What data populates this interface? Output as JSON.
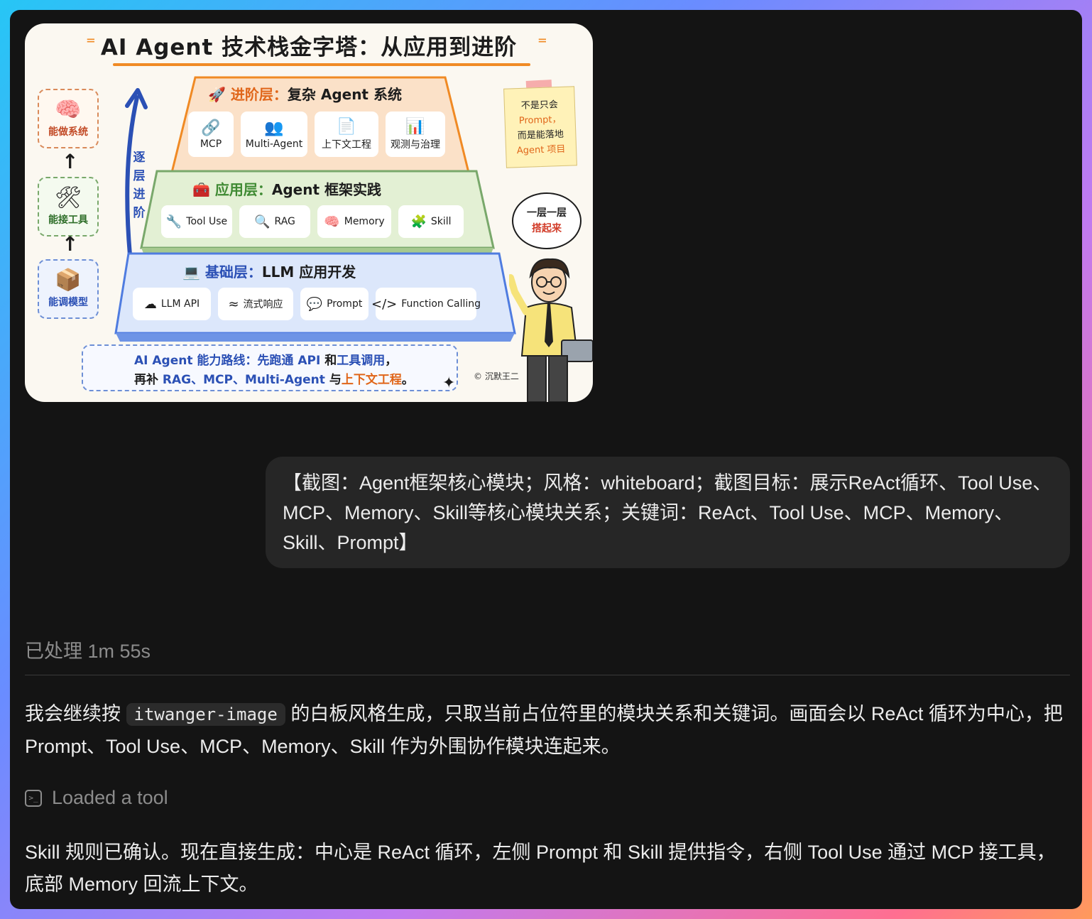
{
  "image": {
    "title": "AI Agent 技术栈金字塔：从应用到进阶",
    "side_labels": [
      "能做系统",
      "能接工具",
      "能调模型"
    ],
    "climb_text": "逐层进阶",
    "advanced": {
      "title_prefix": "进阶层：",
      "title_rest": "复杂 Agent 系统",
      "items": [
        {
          "label": "MCP",
          "icon": "link-icon"
        },
        {
          "label": "Multi-Agent",
          "icon": "people-icon"
        },
        {
          "label": "上下文工程",
          "icon": "document-icon"
        },
        {
          "label": "观测与治理",
          "icon": "dashboard-icon"
        }
      ]
    },
    "application": {
      "title_prefix": "应用层：",
      "title_rest": "Agent 框架实践",
      "items": [
        {
          "label": "Tool Use",
          "icon": "wrench-icon"
        },
        {
          "label": "RAG",
          "icon": "magnifier-icon"
        },
        {
          "label": "Memory",
          "icon": "brain-icon"
        },
        {
          "label": "Skill",
          "icon": "puzzle-icon"
        }
      ]
    },
    "foundation": {
      "title_prefix": "基础层：",
      "title_rest": "LLM 应用开发",
      "items": [
        {
          "label": "LLM API",
          "icon": "cloud-api-icon"
        },
        {
          "label": "流式响应",
          "icon": "wave-icon"
        },
        {
          "label": "Prompt",
          "icon": "chat-bubble-icon"
        },
        {
          "label": "Function Calling",
          "icon": "code-icon"
        }
      ]
    },
    "note": {
      "l1": "不是只会",
      "l2": "Prompt，",
      "l3": "而是能落地",
      "l4": "Agent 项目"
    },
    "bubble": {
      "l1": "一层一层",
      "l2": "搭起来"
    },
    "route": {
      "p1": "AI Agent 能力路线：先跑通 ",
      "api": "API",
      "p2": " 和",
      "tool": "工具调用",
      "p3": "，",
      "p4": "再补 ",
      "rag": "RAG、MCP、Multi-Agent",
      "p5": " 与",
      "ctx": "上下文工程",
      "p6": "。"
    },
    "copyright": "© 沉默王二"
  },
  "user_message": "【截图：Agent框架核心模块；风格：whiteboard；截图目标：展示ReAct循环、Tool Use、MCP、Memory、Skill等核心模块关系；关键词：ReAct、Tool Use、MCP、Memory、Skill、Prompt】",
  "processed_label": "已处理 1m 55s",
  "reply1": {
    "before": "我会继续按 ",
    "code": "itwanger-image",
    "after": " 的白板风格生成，只取当前占位符里的模块关系和关键词。画面会以 ReAct 循环为中心，把 Prompt、Tool Use、MCP、Memory、Skill 作为外围协作模块连起来。"
  },
  "tool_status": "Loaded a tool",
  "reply2": "Skill 规则已确认。现在直接生成：中心是 ReAct 循环，左侧 Prompt 和 Skill 提供指令，右侧 Tool Use 通过 MCP 接工具，底部 Memory 回流上下文。",
  "colors": {
    "advanced_tier": "#fbe1c8",
    "application_tier": "#e3f0d4",
    "foundation_tier": "#dce7fb",
    "window_bg": "#141414",
    "user_bubble": "#262626"
  }
}
